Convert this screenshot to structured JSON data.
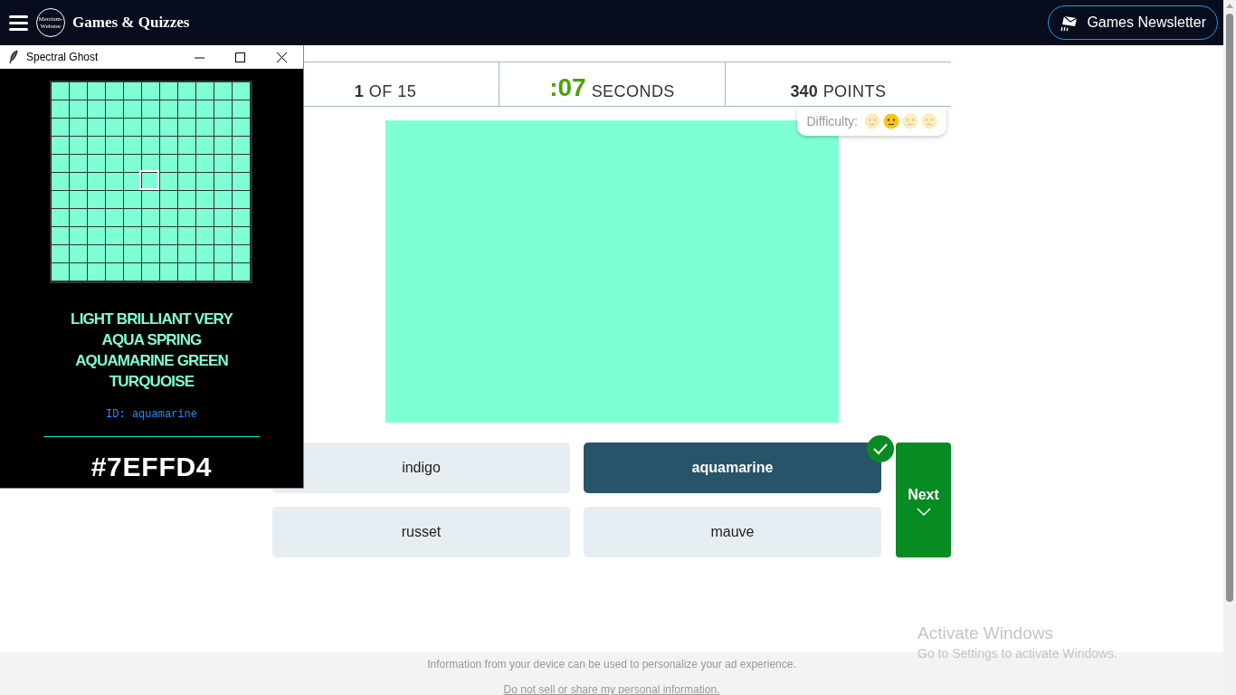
{
  "header": {
    "logo": [
      "Merriam-",
      "Webster"
    ],
    "title": "Games & Quizzes",
    "newsletter_button": "Games Newsletter"
  },
  "stats": [
    {
      "value": "1",
      "label": "OF 15",
      "kind": "count"
    },
    {
      "value": ":07",
      "label": "SECONDS",
      "kind": "timer"
    },
    {
      "value": "340",
      "label": "POINTS",
      "kind": "score"
    }
  ],
  "difficulty": {
    "label": "Difficulty:",
    "levels": [
      {
        "selected": false
      },
      {
        "selected": true
      },
      {
        "selected": false
      },
      {
        "selected": false
      }
    ]
  },
  "answers": [
    {
      "label": "indigo",
      "selected": false
    },
    {
      "label": "aquamarine",
      "selected": true
    },
    {
      "label": "russet",
      "selected": false
    },
    {
      "label": "mauve",
      "selected": false
    }
  ],
  "next_button": "Next",
  "footer": {
    "notice": "Information from your device can be used to personalize your ad experience.",
    "link": "Do not sell or share my personal information."
  },
  "overlay_window": {
    "title": "Spectral Ghost",
    "names": [
      "LIGHT BRILLIANT VERY",
      "AQUA SPRING",
      "AQUAMARINE GREEN",
      "TURQUOISE"
    ],
    "id": "ID: aquamarine",
    "hex": "#7EFFD4"
  },
  "activation": {
    "title": "Activate Windows",
    "subtitle": "Go to Settings to activate Windows."
  }
}
